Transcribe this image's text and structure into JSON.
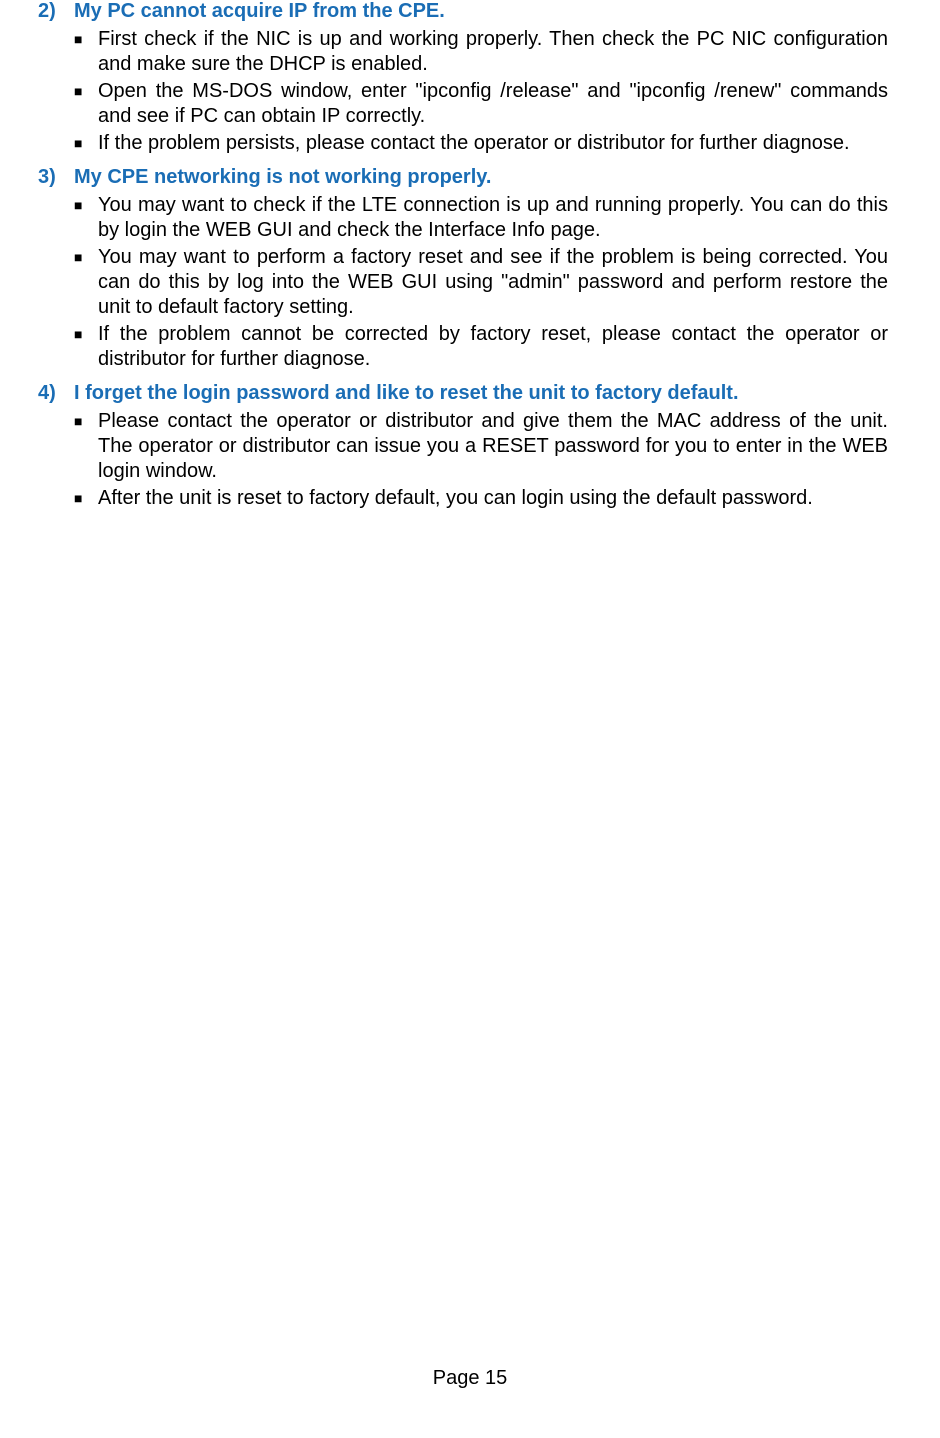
{
  "sections": [
    {
      "number": "2)",
      "title": "My PC cannot acquire IP from the CPE.",
      "bullets": [
        "First check if the NIC is up and working properly. Then check the PC NIC configuration and make sure the DHCP is enabled.",
        "Open the MS-DOS window, enter \"ipconfig /release\" and \"ipconfig /renew\" commands and see if PC can obtain IP correctly.",
        "If the problem persists, please contact the operator or distributor for further diagnose."
      ]
    },
    {
      "number": "3)",
      "title": "My CPE networking is not working properly.",
      "bullets": [
        "You may want to check if the LTE connection is up and running properly. You can do this by login the WEB GUI and check the Interface Info page.",
        "You may want to perform a factory reset and see if the problem is being corrected. You can do this by log into the WEB GUI using \"admin\" password and perform restore the unit to default factory setting.",
        "If the problem cannot be corrected by factory reset, please contact the operator or distributor for further diagnose."
      ]
    },
    {
      "number": "4)",
      "title": "I forget the login password and like to reset the unit to factory default.",
      "bullets": [
        "Please contact the operator or distributor and give them the MAC address of the unit. The operator or distributor can issue you a RESET password for you to enter in the WEB login window.",
        "After the unit is reset to factory default, you can login using the default password."
      ]
    }
  ],
  "pageNumber": "Page 15"
}
